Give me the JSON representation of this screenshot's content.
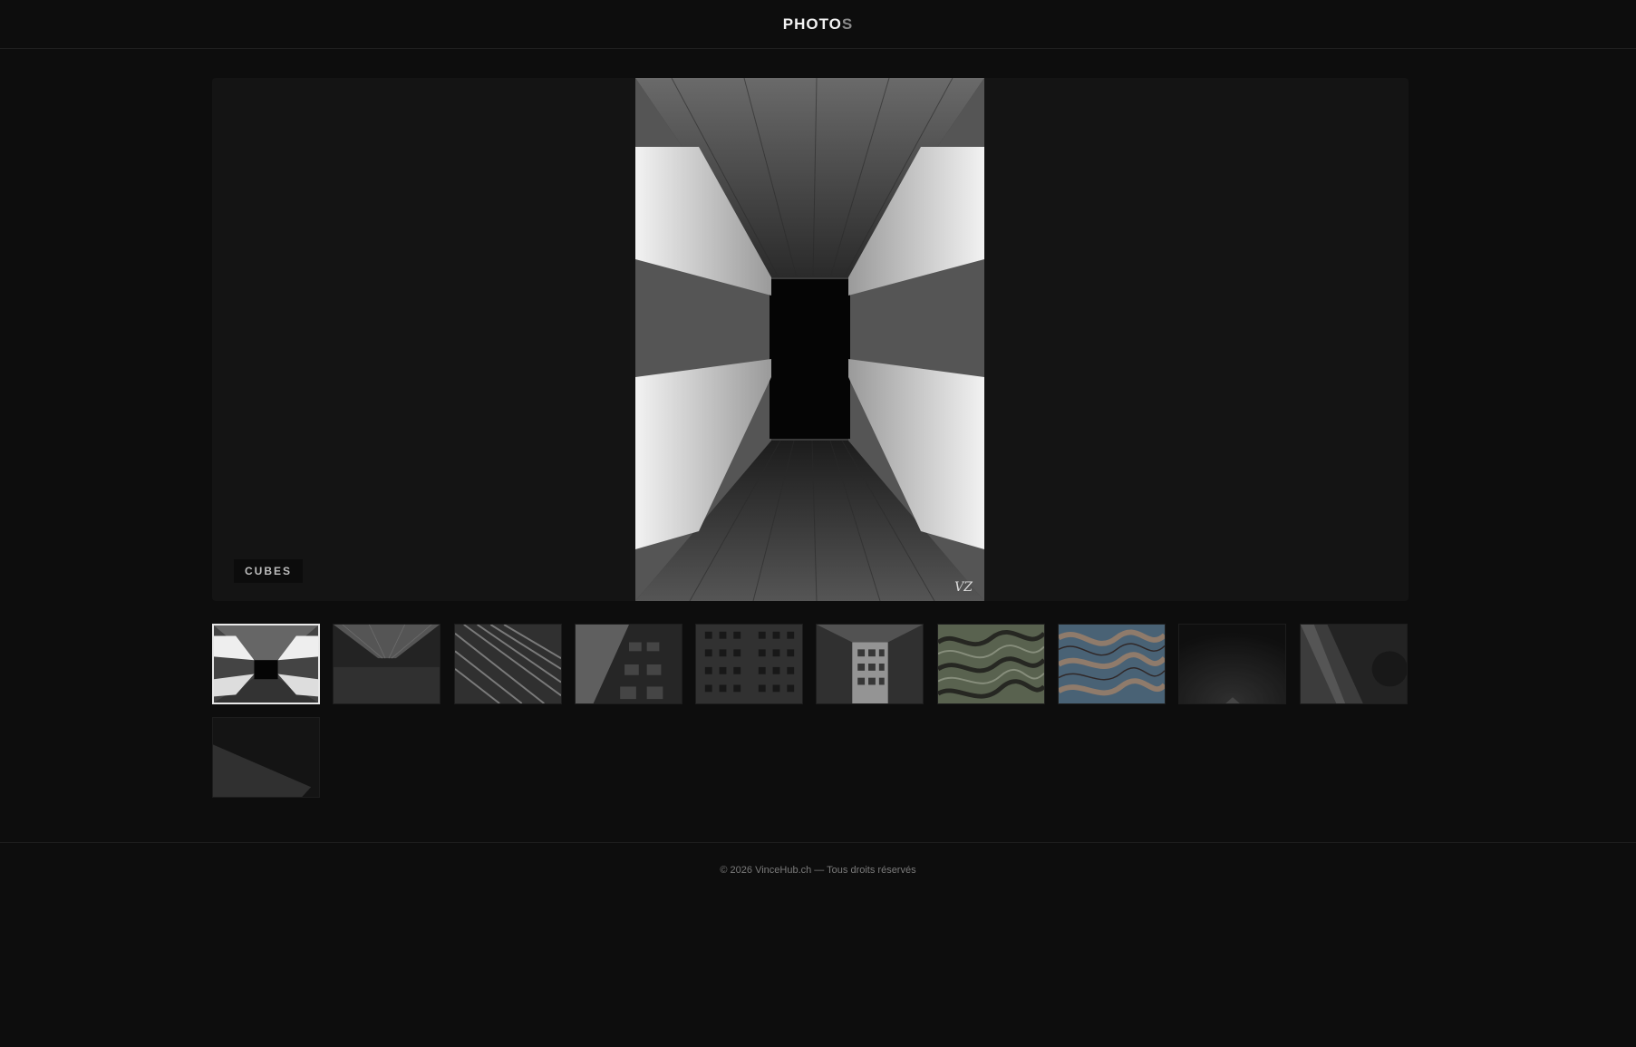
{
  "header": {
    "brand_main": "PHOTO",
    "brand_accent": "S"
  },
  "viewer": {
    "caption": "CUBES"
  },
  "thumbnails": [
    {
      "label": "cubes-corridor",
      "active": true
    },
    {
      "label": "tunnel"
    },
    {
      "label": "facade-lines"
    },
    {
      "label": "balconies"
    },
    {
      "label": "tower-grid"
    },
    {
      "label": "courtyard"
    },
    {
      "label": "green-pattern"
    },
    {
      "label": "blue-pattern"
    },
    {
      "label": "dark-gradient"
    },
    {
      "label": "diagonal-wall"
    },
    {
      "label": "dark-slope"
    }
  ],
  "footer": {
    "text": "© 2026 VinceHub.ch — Tous droits réservés"
  }
}
